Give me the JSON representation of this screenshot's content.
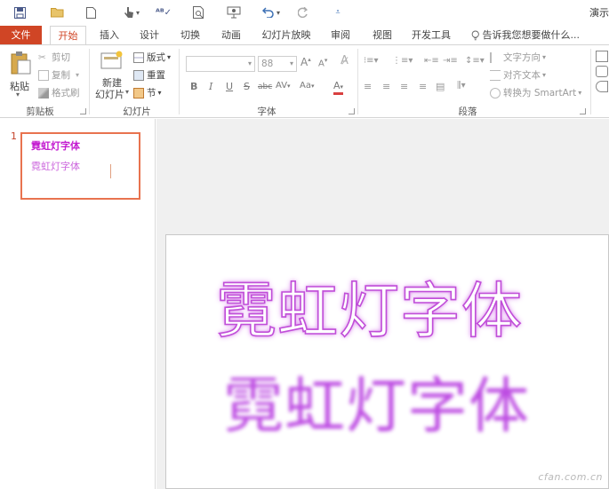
{
  "qat": {
    "window_title": "演示"
  },
  "tabs": {
    "file": "文件",
    "items": [
      "开始",
      "插入",
      "设计",
      "切换",
      "动画",
      "幻灯片放映",
      "审阅",
      "视图",
      "开发工具"
    ],
    "tell_me": "告诉我您想要做什么..."
  },
  "ribbon": {
    "clipboard": {
      "paste": "粘贴",
      "cut": "剪切",
      "copy": "复制",
      "format_painter": "格式刷",
      "group": "剪贴板"
    },
    "slides": {
      "new_slide_line1": "新建",
      "new_slide_line2": "幻灯片",
      "layout": "版式",
      "reset": "重置",
      "section": "节",
      "group": "幻灯片"
    },
    "font": {
      "size": "88",
      "bold": "B",
      "italic": "I",
      "underline": "U",
      "strike": "S",
      "shadow": "abc",
      "spacing": "AV",
      "case": "Aa",
      "color": "A",
      "grow": "A",
      "shrink": "A",
      "group": "字体"
    },
    "paragraph": {
      "text_direction": "文字方向",
      "align_text": "对齐文本",
      "smartart": "转换为 SmartArt",
      "group": "段落"
    }
  },
  "thumbnails": [
    {
      "number": "1",
      "line1": "霓虹灯字体",
      "line2": "霓虹灯字体"
    }
  ],
  "slide": {
    "text1": "霓虹灯字体",
    "text2": "霓虹灯字体"
  },
  "watermark": "cfan.com.cn",
  "colors": {
    "accent": "#d04525",
    "neon": "#c04ed8"
  }
}
